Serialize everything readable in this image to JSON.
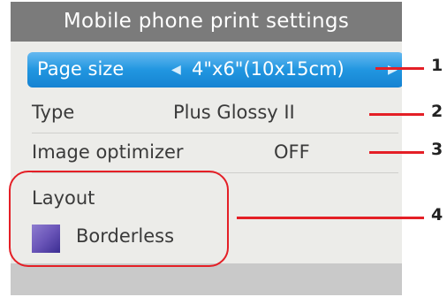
{
  "screen": {
    "title": "Mobile phone print settings",
    "page_size": {
      "label": "Page size",
      "value": "4\"x6\"(10x15cm)",
      "arrow_left": "◀",
      "arrow_right": "▶"
    },
    "type": {
      "label": "Type",
      "value": "Plus Glossy II"
    },
    "image_optimizer": {
      "label": "Image optimizer",
      "value": "OFF"
    },
    "layout": {
      "label": "Layout",
      "value": "Borderless",
      "icon": "borderless-layout-icon"
    }
  },
  "callouts": [
    "1",
    "2",
    "3",
    "4"
  ],
  "colors": {
    "titlebar": "#7b7b7b",
    "selected_row": "#1f8fdc",
    "highlight": "#e41f26",
    "screen_bg": "#ecece9"
  }
}
